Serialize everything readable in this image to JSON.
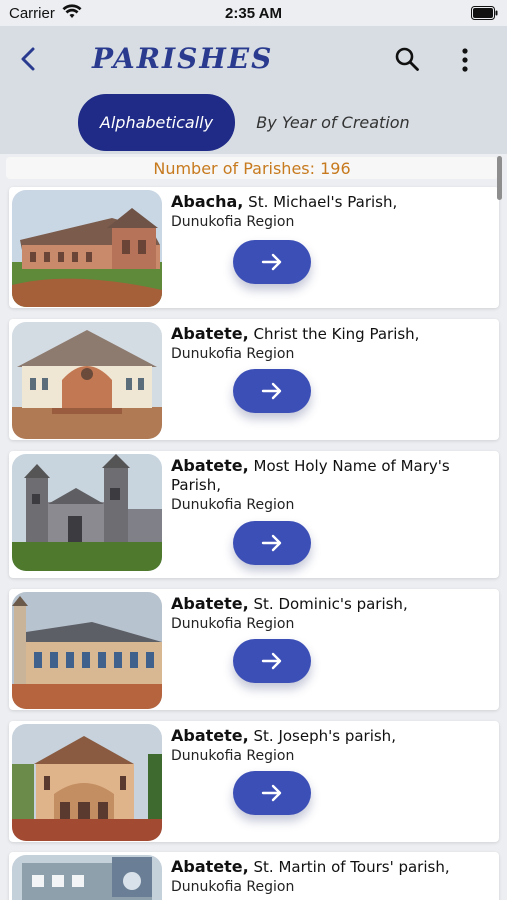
{
  "status_bar": {
    "carrier": "Carrier",
    "time": "2:35 AM"
  },
  "header": {
    "title": "PARISHES",
    "icons": [
      "chevron-left-icon",
      "search-icon",
      "more-vertical-icon"
    ],
    "tabs": [
      {
        "label": "Alphabetically",
        "selected": true
      },
      {
        "label": "By Year of Creation",
        "selected": false
      }
    ]
  },
  "parish_count": "Number of Parishes: 196",
  "parishes": [
    {
      "town": "Abacha,",
      "name": "St. Michael's Parish,",
      "region": "Dunukofia Region",
      "icon": "arrow-right-icon"
    },
    {
      "town": "Abatete,",
      "name": "Christ the King Parish,",
      "region": "Dunukofia Region",
      "icon": "arrow-right-icon"
    },
    {
      "town": "Abatete,",
      "name": "Most Holy Name of  Mary's Parish,",
      "region": "Dunukofia Region",
      "icon": "arrow-right-icon"
    },
    {
      "town": "Abatete,",
      "name": "St. Dominic's parish,",
      "region": "Dunukofia Region",
      "icon": "arrow-right-icon"
    },
    {
      "town": "Abatete,",
      "name": "St. Joseph's parish,",
      "region": "Dunukofia Region",
      "icon": "arrow-right-icon"
    },
    {
      "town": "Abatete,",
      "name": "St. Martin of Tours' parish,",
      "region": "Dunukofia Region",
      "icon": "arrow-right-icon"
    }
  ],
  "colors": {
    "header_bg": "#d7dde3",
    "accent_dark": "#1f2b86",
    "button_blue": "#3c4fb6",
    "count_text": "#c77a1e"
  }
}
